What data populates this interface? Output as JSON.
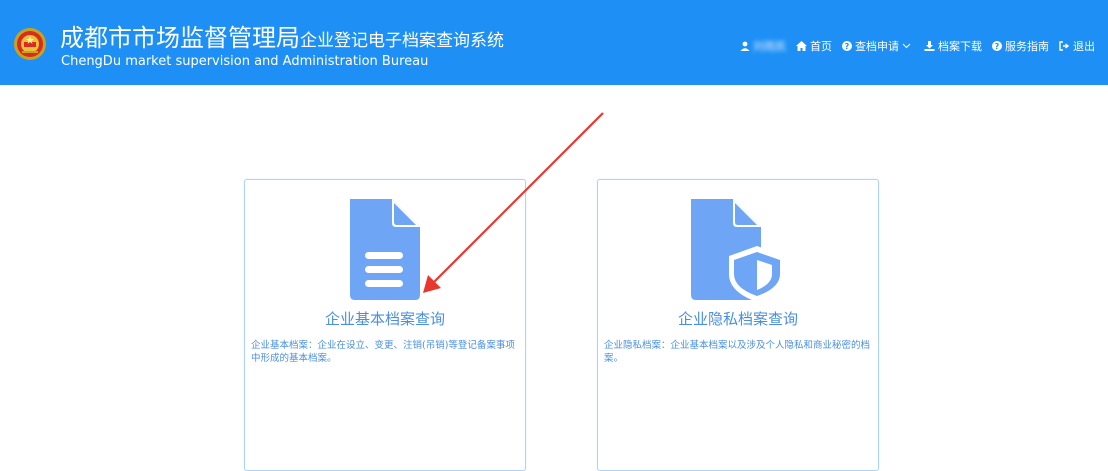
{
  "header": {
    "title_main": "成都市市场监督管理局",
    "title_suffix": "企业登记电子档案查询系统",
    "subtitle": "ChengDu market supervision and Administration Bureau",
    "brand_color": "#1e90f5"
  },
  "nav": {
    "user_name": "刘雨凯",
    "items": [
      {
        "label": "首页",
        "icon": "home-icon"
      },
      {
        "label": "查档申请",
        "icon": "question-circle-icon",
        "has_dropdown": true
      },
      {
        "label": "档案下载",
        "icon": "download-icon"
      },
      {
        "label": "服务指南",
        "icon": "question-circle-icon"
      },
      {
        "label": "退出",
        "icon": "sign-out-icon"
      }
    ]
  },
  "cards": [
    {
      "title": "企业基本档案查询",
      "description": "企业基本档案：企业在设立、变更、注销(吊销)等登记备案事项中形成的基本档案。",
      "icon": "document-icon"
    },
    {
      "title": "企业隐私档案查询",
      "description": "企业隐私档案：企业基本档案以及涉及个人隐私和商业秘密的档案。",
      "icon": "document-shield-icon"
    }
  ],
  "colors": {
    "accent": "#4a8fe0",
    "icon_fill": "#6ea5f5",
    "card_border": "#aed3f5",
    "annotation_arrow": "#e8382e"
  }
}
